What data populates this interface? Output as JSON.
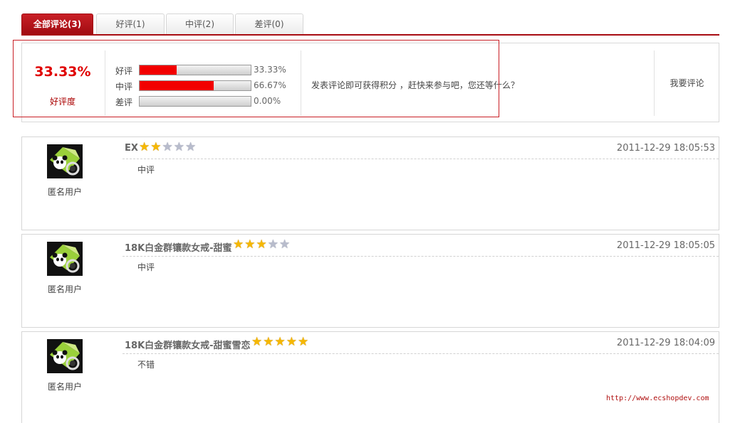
{
  "tabs": [
    {
      "label": "全部评论(3)",
      "active": true
    },
    {
      "label": "好评(1)",
      "active": false
    },
    {
      "label": "中评(2)",
      "active": false
    },
    {
      "label": "差评(0)",
      "active": false
    }
  ],
  "summary": {
    "rate_value": "33.33%",
    "rate_label": "好评度",
    "bars": [
      {
        "label": "好评",
        "percent": 33.33,
        "percent_text": "33.33%"
      },
      {
        "label": "中评",
        "percent": 66.67,
        "percent_text": "66.67%"
      },
      {
        "label": "差评",
        "percent": 0,
        "percent_text": "0.00%"
      }
    ],
    "prompt": "发表评论即可获得积分 ，赶快来参与吧，您还等什么？",
    "write_label": "我要评论"
  },
  "reviews": [
    {
      "user": "匿名用户",
      "title": "EX",
      "stars": 2,
      "time": "2011-12-29 18:05:53",
      "content": "中评"
    },
    {
      "user": "匿名用户",
      "title": "18K白金群镶款女戒-甜蜜",
      "stars": 3,
      "time": "2011-12-29 18:05:05",
      "content": "中评"
    },
    {
      "user": "匿名用户",
      "title": "18K白金群镶款女戒-甜蜜雪恋",
      "stars": 5,
      "time": "2011-12-29 18:04:09",
      "content": "不错"
    }
  ],
  "watermark": "http://www.ecshopdev.com",
  "colors": {
    "accent": "#a80c12",
    "bar_fill": "#f20000",
    "star_on": "#f6b800",
    "star_off": "#b8bccc"
  }
}
